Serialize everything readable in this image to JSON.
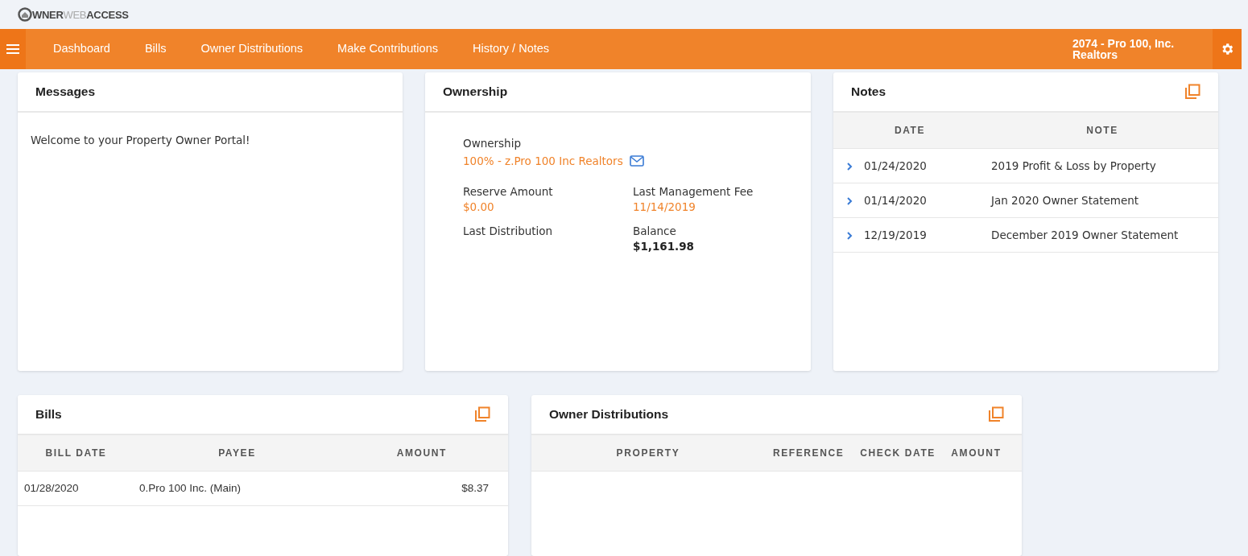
{
  "logo": {
    "parts": [
      "WNER",
      "WEB",
      "ACCESS"
    ]
  },
  "nav": {
    "items": [
      {
        "label": "Dashboard",
        "selected": false
      },
      {
        "label": "Bills",
        "selected": false
      },
      {
        "label": "Owner Distributions",
        "selected": false
      },
      {
        "label": "Make Contributions",
        "selected": false
      },
      {
        "label": "History / Notes",
        "selected": false
      }
    ],
    "account": "2074 - Pro 100, Inc. Realtors"
  },
  "messages": {
    "title": "Messages",
    "text": "Welcome to your Property Owner Portal!"
  },
  "ownership": {
    "title": "Ownership",
    "label": "Ownership",
    "value": "100% -  z.Pro 100 Inc Realtors",
    "fields": [
      {
        "label": "Reserve Amount",
        "value": "$0.00",
        "kind": "link"
      },
      {
        "label": "Last Management Fee",
        "value": "11/14/2019",
        "kind": "link"
      },
      {
        "label": "Last Distribution",
        "kind": "empty"
      },
      {
        "label": "Balance",
        "value": "$1,161.98",
        "kind": "bold"
      }
    ]
  },
  "notes": {
    "title": "Notes",
    "columns": [
      "DATE",
      "NOTE"
    ],
    "rows": [
      {
        "date": "01/24/2020",
        "note": "2019 Profit & Loss by Property"
      },
      {
        "date": "01/14/2020",
        "note": "Jan 2020 Owner Statement"
      },
      {
        "date": "12/19/2019",
        "note": "December 2019 Owner Statement"
      }
    ]
  },
  "bills": {
    "title": "Bills",
    "columns": [
      "BILL DATE",
      "PAYEE",
      "AMOUNT"
    ],
    "rows": [
      {
        "bill_date": "01/28/2020",
        "payee": "0.Pro 100 Inc. (Main)",
        "amount": "$8.37"
      }
    ]
  },
  "owner_distributions": {
    "title": "Owner Distributions",
    "columns": [
      "PROPERTY",
      "REFERENCE",
      "CHECK DATE",
      "AMOUNT"
    ]
  }
}
